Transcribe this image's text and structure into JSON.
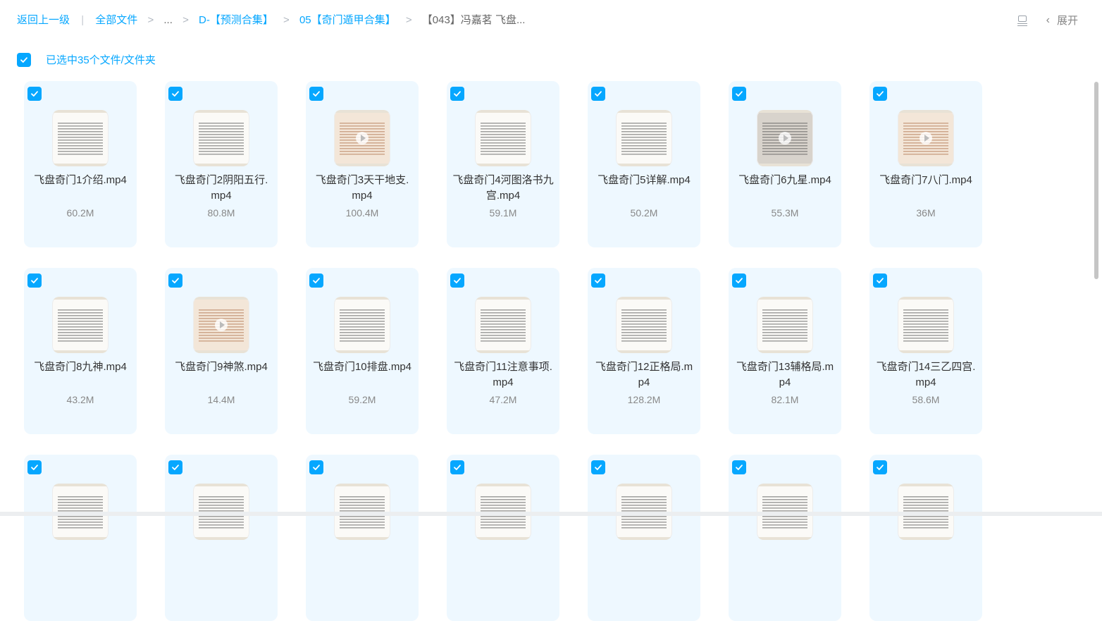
{
  "breadcrumb": {
    "back": "返回上一级",
    "divider": "|",
    "all_files": "全部文件",
    "sep": ">",
    "ellipsis": "...",
    "level1": "D-【预测合集】",
    "level2": "05【奇门遁甲合集】",
    "current": "【043】冯嘉茗 飞盘..."
  },
  "top_right": {
    "view_icon": "list-view-icon",
    "chevron": "‹",
    "expand_label": "展开"
  },
  "selection": {
    "text": "已选中35个文件/文件夹"
  },
  "files": [
    {
      "name": "飞盘奇门1介绍.mp4",
      "size": "60.2M",
      "thumb": "doc"
    },
    {
      "name": "飞盘奇门2阴阳五行.mp4",
      "size": "80.8M",
      "thumb": "doc"
    },
    {
      "name": "飞盘奇门3天干地支.mp4",
      "size": "100.4M",
      "thumb": "warm"
    },
    {
      "name": "飞盘奇门4河图洛书九宫.mp4",
      "size": "59.1M",
      "thumb": "doc"
    },
    {
      "name": "飞盘奇门5详解.mp4",
      "size": "50.2M",
      "thumb": "doc"
    },
    {
      "name": "飞盘奇门6九星.mp4",
      "size": "55.3M",
      "thumb": "grey"
    },
    {
      "name": "飞盘奇门7八门.mp4",
      "size": "36M",
      "thumb": "warm"
    },
    {
      "name": "飞盘奇门8九神.mp4",
      "size": "43.2M",
      "thumb": "doc"
    },
    {
      "name": "飞盘奇门9神煞.mp4",
      "size": "14.4M",
      "thumb": "warm"
    },
    {
      "name": "飞盘奇门10排盘.mp4",
      "size": "59.2M",
      "thumb": "doc"
    },
    {
      "name": "飞盘奇门11注意事项.mp4",
      "size": "47.2M",
      "thumb": "doc"
    },
    {
      "name": "飞盘奇门12正格局.mp4",
      "size": "128.2M",
      "thumb": "doc"
    },
    {
      "name": "飞盘奇门13辅格局.mp4",
      "size": "82.1M",
      "thumb": "doc"
    },
    {
      "name": "飞盘奇门14三乙四宫.mp4",
      "size": "58.6M",
      "thumb": "doc"
    },
    {
      "name": "",
      "size": "",
      "thumb": "doc"
    },
    {
      "name": "",
      "size": "",
      "thumb": "doc"
    },
    {
      "name": "",
      "size": "",
      "thumb": "doc"
    },
    {
      "name": "",
      "size": "",
      "thumb": "doc"
    },
    {
      "name": "",
      "size": "",
      "thumb": "doc"
    },
    {
      "name": "",
      "size": "",
      "thumb": "doc"
    },
    {
      "name": "",
      "size": "",
      "thumb": "doc"
    }
  ],
  "colors": {
    "accent": "#06a7ff",
    "card_bg": "#eef8ff"
  }
}
